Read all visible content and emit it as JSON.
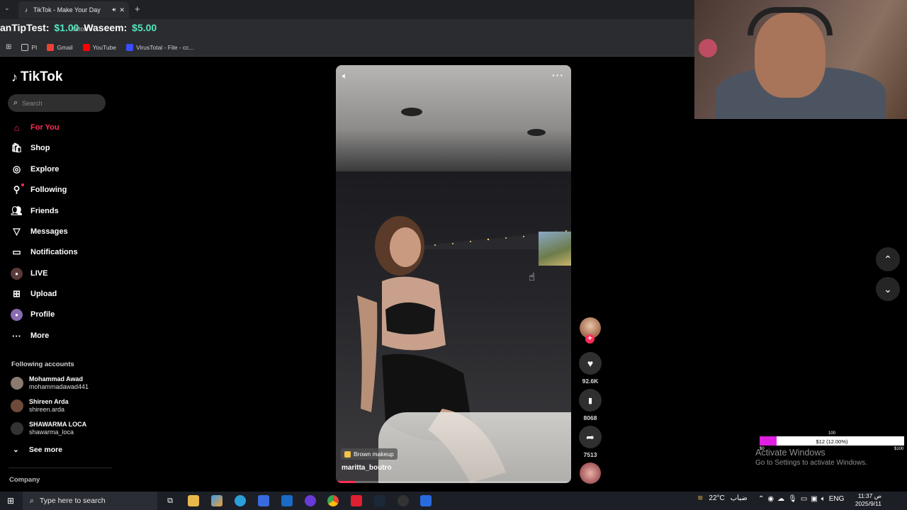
{
  "browser": {
    "tab_title": "TikTok - Make Your Day",
    "tab_close": "✕",
    "new_tab": "+",
    "address_fragment": "tiktok",
    "bookmarks": [
      {
        "label": "PI",
        "icon": "folder-icon",
        "color": "#c9c9c9"
      },
      {
        "label": "Gmail",
        "icon": "gmail-icon",
        "color": "#ea4335"
      },
      {
        "label": "YouTube",
        "icon": "youtube-icon",
        "color": "#ff0000"
      },
      {
        "label": "VirusTotal - File - cc...",
        "icon": "virustotal-icon",
        "color": "#394eff"
      }
    ]
  },
  "tip_overlay": {
    "name1": "anTipTest:",
    "amount1": "$1.00",
    "name2": "Waseem:",
    "amount2": "$5.00"
  },
  "sidebar": {
    "logo": "TikTok",
    "search_placeholder": "Search",
    "nav": [
      {
        "label": "For You",
        "icon": "home-icon",
        "active": true
      },
      {
        "label": "Shop",
        "icon": "shop-icon"
      },
      {
        "label": "Explore",
        "icon": "compass-icon"
      },
      {
        "label": "Following",
        "icon": "following-icon",
        "dot": true
      },
      {
        "label": "Friends",
        "icon": "friends-icon"
      },
      {
        "label": "Messages",
        "icon": "messages-icon"
      },
      {
        "label": "Notifications",
        "icon": "notifications-icon"
      },
      {
        "label": "LIVE",
        "icon": "live-icon"
      },
      {
        "label": "Upload",
        "icon": "upload-icon"
      },
      {
        "label": "Profile",
        "icon": "profile-icon"
      },
      {
        "label": "More",
        "icon": "more-icon"
      }
    ],
    "following_title": "Following accounts",
    "accounts": [
      {
        "name": "Mohammad Awad",
        "handle": "mohammadawad441"
      },
      {
        "name": "Shireen Arda",
        "handle": "shireen.arda"
      },
      {
        "name": "SHAWARMA LOCA",
        "handle": "shawarma_loca"
      }
    ],
    "see_more": "See more",
    "company": "Company"
  },
  "video": {
    "tag": "Brown makeup",
    "author": "maritta_boutro",
    "progress": 0.08,
    "more": "···"
  },
  "actions": {
    "likes": "92.6K",
    "saves": "8068",
    "shares": "7513"
  },
  "donation": {
    "goal_top": "100",
    "label": "$12 (12.00%)",
    "min": "$0",
    "max": "$100",
    "progress": 0.12
  },
  "watermark": {
    "line1": "Activate Windows",
    "line2": "Go to Settings to activate Windows."
  },
  "taskbar": {
    "search_placeholder": "Type here to search",
    "temperature": "22°C",
    "weather_text": "ضباب",
    "language": "ENG",
    "time": "11:37 ص",
    "date": "2025/9/11"
  }
}
